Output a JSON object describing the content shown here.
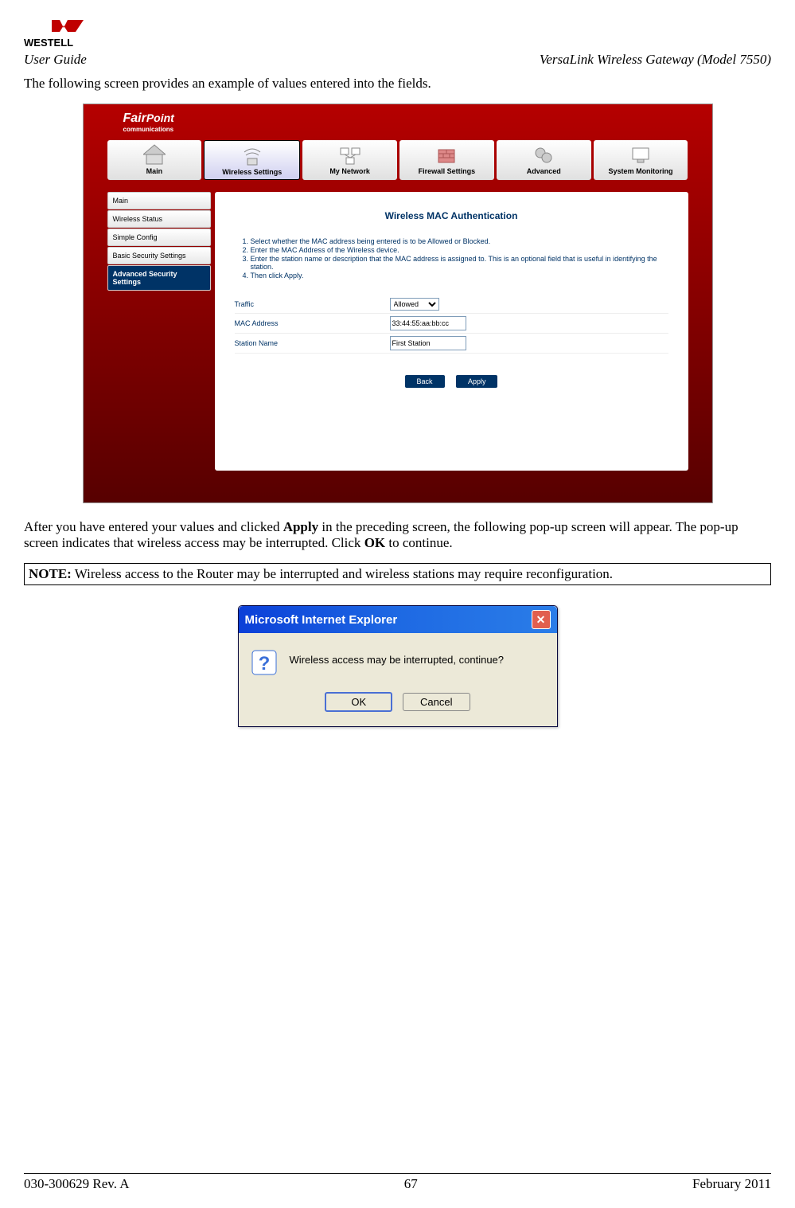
{
  "brand": "WESTELL",
  "header": {
    "left": "User Guide",
    "right": "VersaLink Wireless Gateway (Model 7550)"
  },
  "intro": "The following screen provides an example of values entered into the fields.",
  "screenshot1": {
    "logo": "FairPoint communications",
    "tabs": [
      {
        "label": "Main"
      },
      {
        "label": "Wireless Settings",
        "active": true
      },
      {
        "label": "My Network"
      },
      {
        "label": "Firewall Settings"
      },
      {
        "label": "Advanced"
      },
      {
        "label": "System Monitoring"
      }
    ],
    "sidebar": [
      {
        "label": "Main"
      },
      {
        "label": "Wireless Status"
      },
      {
        "label": "Simple Config"
      },
      {
        "label": "Basic Security Settings"
      },
      {
        "label": "Advanced Security Settings",
        "active": true
      }
    ],
    "content": {
      "title": "Wireless MAC Authentication",
      "instructions": [
        "Select whether the MAC address being entered is to be Allowed or Blocked.",
        "Enter the MAC Address of the Wireless device.",
        "Enter the station name or description that the MAC address is assigned to. This is an optional field that is useful in identifying the station.",
        "Then click Apply."
      ],
      "form": {
        "traffic_label": "Traffic",
        "traffic_value": "Allowed",
        "mac_label": "MAC Address",
        "mac_value": "33:44:55:aa:bb:cc",
        "station_label": "Station Name",
        "station_value": "First Station"
      },
      "buttons": {
        "back": "Back",
        "apply": "Apply"
      }
    }
  },
  "para2_pre": "After you have entered your values and clicked ",
  "para2_bold1": "Apply",
  "para2_mid": " in the preceding screen, the following pop-up screen will appear. The pop-up screen indicates that wireless access may be interrupted. Click ",
  "para2_bold2": "OK",
  "para2_post": " to continue.",
  "note_bold": "NOTE:",
  "note_text": " Wireless access to the Router may be interrupted and wireless stations may require reconfiguration.",
  "dialog": {
    "title": "Microsoft Internet Explorer",
    "message": "Wireless access may be interrupted, continue?",
    "ok": "OK",
    "cancel": "Cancel"
  },
  "footer": {
    "left": "030-300629 Rev. A",
    "center": "67",
    "right": "February 2011"
  }
}
